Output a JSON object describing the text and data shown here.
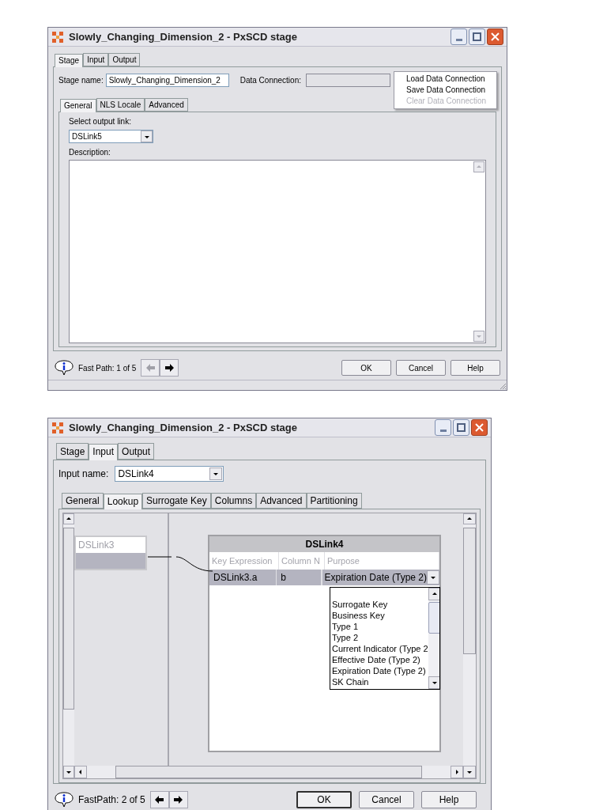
{
  "stage_dialog": {
    "title": "Slowly_Changing_Dimension_2 - PxSCD stage",
    "tabs": [
      {
        "label": "Stage",
        "selected": true
      },
      {
        "label": "Input",
        "selected": false
      },
      {
        "label": "Output",
        "selected": false
      }
    ],
    "stage_name": {
      "label": "Stage name:",
      "value": "Slowly_Changing_Dimension_2"
    },
    "data_connection": {
      "label": "Data Connection:"
    },
    "connection_menu": [
      {
        "label": "Load Data Connection",
        "disabled": false
      },
      {
        "label": "Save Data Connection",
        "disabled": false
      },
      {
        "label": "Clear Data Connection",
        "disabled": true
      }
    ],
    "subtabs": [
      {
        "label": "General",
        "selected": true
      },
      {
        "label": "NLS Locale",
        "selected": false
      },
      {
        "label": "Advanced",
        "selected": false
      }
    ],
    "output_link": {
      "label": "Select output link:",
      "value": "DSLink5"
    },
    "description": {
      "label": "Description:"
    },
    "fast_path": "Fast Path: 1 of 5",
    "nav_buttons": [
      {
        "kind": "back",
        "disabled": true
      },
      {
        "kind": "forward",
        "disabled": false
      }
    ],
    "buttons": [
      {
        "label": "OK",
        "default": false
      },
      {
        "label": "Cancel",
        "default": false
      },
      {
        "label": "Help",
        "default": false
      }
    ]
  },
  "input_dialog": {
    "title": "Slowly_Changing_Dimension_2 - PxSCD stage",
    "tabs": [
      {
        "label": "Stage",
        "selected": false
      },
      {
        "label": "Input",
        "selected": true
      },
      {
        "label": "Output",
        "selected": false
      }
    ],
    "input_name": {
      "label": "Input name:",
      "value": "DSLink4"
    },
    "subtabs": [
      {
        "label": "General",
        "selected": false
      },
      {
        "label": "Lookup",
        "selected": true
      },
      {
        "label": "Surrogate Key",
        "selected": false
      },
      {
        "label": "Columns",
        "selected": false
      },
      {
        "label": "Advanced",
        "selected": false
      },
      {
        "label": "Partitioning",
        "selected": false
      }
    ],
    "source_link": {
      "name": "DSLink3",
      "row_selected": true
    },
    "target_link": {
      "name": "DSLink4",
      "columns": [
        "Key Expression",
        "Column N",
        "Purpose"
      ],
      "rows": [
        {
          "cells": [
            "DSLink3.a",
            "b",
            "Expiration Date (Type 2)"
          ],
          "selected": true
        }
      ]
    },
    "purpose_options": [
      "Surrogate Key",
      "Business Key",
      "Type 1",
      "Type 2",
      "Current Indicator (Type 2",
      "Effective Date (Type 2)",
      "Expiration Date (Type 2)",
      "SK Chain"
    ],
    "fast_path": "FastPath: 2 of 5",
    "nav_buttons": [
      {
        "kind": "back",
        "disabled": false
      },
      {
        "kind": "forward",
        "disabled": false
      }
    ],
    "buttons": [
      {
        "label": "OK",
        "default": true
      },
      {
        "label": "Cancel",
        "default": false
      },
      {
        "label": "Help",
        "default": false
      }
    ]
  }
}
